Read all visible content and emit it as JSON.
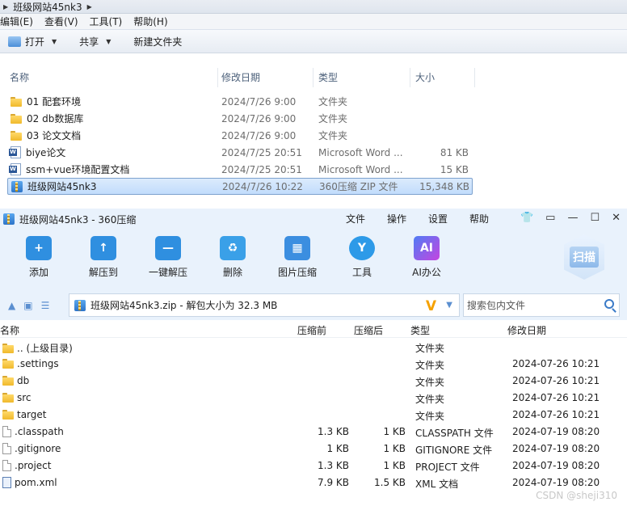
{
  "explorer": {
    "breadcrumb": "班级网站45nk3",
    "menu": [
      "编辑(E)",
      "查看(V)",
      "工具(T)",
      "帮助(H)"
    ],
    "toolbar": {
      "open": "打开",
      "share": "共享",
      "new_folder": "新建文件夹"
    },
    "columns": {
      "name": "名称",
      "date": "修改日期",
      "type": "类型",
      "size": "大小"
    },
    "files": [
      {
        "name": "01 配套环境",
        "date": "2024/7/26 9:00",
        "type": "文件夹",
        "size": "",
        "icon": "folder-icon"
      },
      {
        "name": "02 db数据库",
        "date": "2024/7/26 9:00",
        "type": "文件夹",
        "size": "",
        "icon": "folder-icon"
      },
      {
        "name": "03 论文文档",
        "date": "2024/7/26 9:00",
        "type": "文件夹",
        "size": "",
        "icon": "folder-icon"
      },
      {
        "name": "biye论文",
        "date": "2024/7/25 20:51",
        "type": "Microsoft Word ...",
        "size": "81 KB",
        "icon": "word-doc-icon"
      },
      {
        "name": "ssm+vue环境配置文档",
        "date": "2024/7/25 20:51",
        "type": "Microsoft Word ...",
        "size": "15 KB",
        "icon": "word-doc-icon"
      },
      {
        "name": "班级网站45nk3",
        "date": "2024/7/26 10:22",
        "type": "360压缩 ZIP 文件",
        "size": "15,348 KB",
        "icon": "zip-icon",
        "selected": true
      }
    ]
  },
  "zip": {
    "title": "班级网站45nk3 - 360压缩",
    "menu": [
      "文件",
      "操作",
      "设置",
      "帮助"
    ],
    "tools": [
      {
        "label": "添加",
        "color": "#2f8fe0",
        "glyph": "+"
      },
      {
        "label": "解压到",
        "color": "#2f8fe0",
        "glyph": "↑"
      },
      {
        "label": "一键解压",
        "color": "#2f8fe0",
        "glyph": "—"
      },
      {
        "label": "删除",
        "color": "#3aa0e8",
        "glyph": "♻"
      },
      {
        "label": "图片压缩",
        "color": "#3b8ee0",
        "glyph": "▦"
      },
      {
        "label": "工具",
        "color": "#2d9ae8",
        "glyph": "Y"
      },
      {
        "label": "AI办公",
        "color": "#b04de6",
        "glyph": "AI"
      }
    ],
    "scan_label": "扫描",
    "path": "班级网站45nk3.zip - 解包大小为 32.3 MB",
    "path_badge": "V",
    "search_placeholder": "搜索包内文件",
    "columns": {
      "name": "名称",
      "before": "压缩前",
      "after": "压缩后",
      "type": "类型",
      "date": "修改日期"
    },
    "files": [
      {
        "name": ".. (上级目录)",
        "before": "",
        "after": "",
        "type": "文件夹",
        "date": "",
        "icon": "folder-icon"
      },
      {
        "name": ".settings",
        "before": "",
        "after": "",
        "type": "文件夹",
        "date": "2024-07-26 10:21",
        "icon": "folder-icon"
      },
      {
        "name": "db",
        "before": "",
        "after": "",
        "type": "文件夹",
        "date": "2024-07-26 10:21",
        "icon": "folder-icon"
      },
      {
        "name": "src",
        "before": "",
        "after": "",
        "type": "文件夹",
        "date": "2024-07-26 10:21",
        "icon": "folder-icon"
      },
      {
        "name": "target",
        "before": "",
        "after": "",
        "type": "文件夹",
        "date": "2024-07-26 10:21",
        "icon": "folder-icon"
      },
      {
        "name": ".classpath",
        "before": "1.3 KB",
        "after": "1 KB",
        "type": "CLASSPATH 文件",
        "date": "2024-07-19 08:20",
        "icon": "file-icon"
      },
      {
        "name": ".gitignore",
        "before": "1 KB",
        "after": "1 KB",
        "type": "GITIGNORE 文件",
        "date": "2024-07-19 08:20",
        "icon": "file-icon"
      },
      {
        "name": ".project",
        "before": "1.3 KB",
        "after": "1 KB",
        "type": "PROJECT 文件",
        "date": "2024-07-19 08:20",
        "icon": "file-icon"
      },
      {
        "name": "pom.xml",
        "before": "7.9 KB",
        "after": "1.5 KB",
        "type": "XML 文档",
        "date": "2024-07-19 08:20",
        "icon": "xml-file-icon"
      }
    ]
  },
  "watermark": "CSDN @sheji310"
}
